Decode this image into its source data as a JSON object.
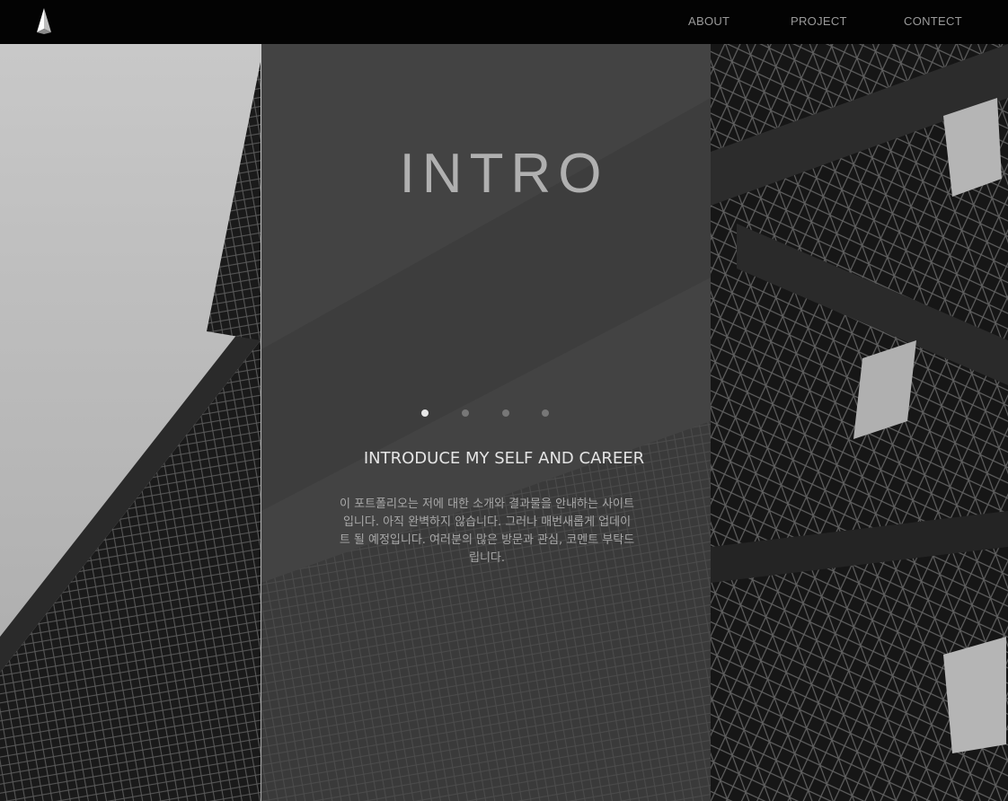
{
  "header": {
    "logo_icon": "pen-nib-icon",
    "nav": [
      {
        "label": "ABOUT"
      },
      {
        "label": "PROJECT"
      },
      {
        "label": "CONTECT"
      }
    ]
  },
  "hero": {
    "background": "eiffel-tower-photo",
    "title": "INTRO",
    "slider": {
      "count": 4,
      "active_index": 0
    },
    "subtitle": "INTRODUCE MY SELF AND CAREER",
    "description": "이 포트폴리오는 저에 대한 소개와 결과물을 안내하는 사이트입니다. 아직 완벽하지 않습니다. 그러나 매번새롭게 업데이트 될 예정입니다. 여러분의 많은 방문과 관심, 코멘트 부탁드립니다."
  },
  "colors": {
    "header_bg": "#030303",
    "nav_text": "#9a9a9a",
    "panel_bg": "rgba(70,70,70,0.72)",
    "title_text": "#b0b0b0",
    "subtitle_text": "#e4e4e4",
    "desc_text": "#a8a8a8",
    "dot_active": "#e8e8e8",
    "dot_inactive": "#777777"
  }
}
